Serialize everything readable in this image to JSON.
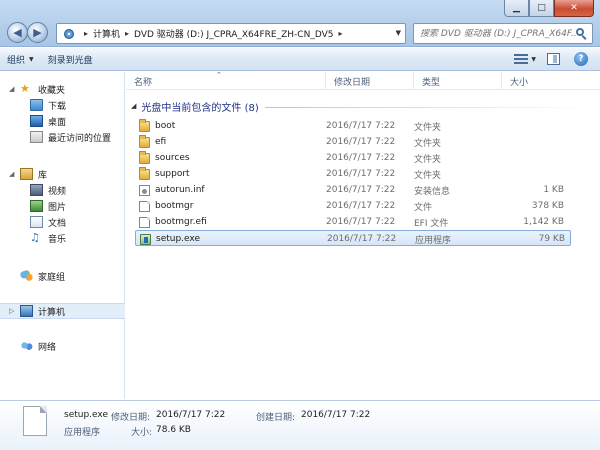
{
  "address": {
    "crumbs": [
      "计算机",
      "DVD 驱动器 (D:) J_CPRA_X64FRE_ZH-CN_DV5"
    ],
    "search_placeholder": "搜索 DVD 驱动器 (D:) J_CPRA_X64F..."
  },
  "toolbar": {
    "organize_label": "组织",
    "burn_label": "刻录到光盘"
  },
  "columns": {
    "name": "名称",
    "date": "修改日期",
    "type": "类型",
    "size": "大小"
  },
  "nav": {
    "favorites": {
      "label": "收藏夹",
      "items": [
        "下载",
        "桌面",
        "最近访问的位置"
      ]
    },
    "libraries": {
      "label": "库",
      "items": [
        "视频",
        "图片",
        "文档",
        "音乐"
      ]
    },
    "homegroup": "家庭组",
    "computer": "计算机",
    "network": "网络"
  },
  "group_header": "光盘中当前包含的文件 (8)",
  "files": [
    {
      "name": "boot",
      "date": "2016/7/17 7:22",
      "type": "文件夹",
      "size": "",
      "icon": "folder-icon"
    },
    {
      "name": "efi",
      "date": "2016/7/17 7:22",
      "type": "文件夹",
      "size": "",
      "icon": "folder-icon"
    },
    {
      "name": "sources",
      "date": "2016/7/17 7:22",
      "type": "文件夹",
      "size": "",
      "icon": "folder-icon"
    },
    {
      "name": "support",
      "date": "2016/7/17 7:22",
      "type": "文件夹",
      "size": "",
      "icon": "folder-icon"
    },
    {
      "name": "autorun.inf",
      "date": "2016/7/17 7:22",
      "type": "安装信息",
      "size": "1 KB",
      "icon": "setup-info-icon"
    },
    {
      "name": "bootmgr",
      "date": "2016/7/17 7:22",
      "type": "文件",
      "size": "378 KB",
      "icon": "file-icon"
    },
    {
      "name": "bootmgr.efi",
      "date": "2016/7/17 7:22",
      "type": "EFI 文件",
      "size": "1,142 KB",
      "icon": "file-icon"
    },
    {
      "name": "setup.exe",
      "date": "2016/7/17 7:22",
      "type": "应用程序",
      "size": "79 KB",
      "icon": "application-icon"
    }
  ],
  "selected_file": "setup.exe",
  "details": {
    "name": "setup.exe",
    "type": "应用程序",
    "modified_label": "修改日期:",
    "modified_value": "2016/7/17 7:22",
    "created_label": "创建日期:",
    "created_value": "2016/7/17 7:22",
    "size_label": "大小:",
    "size_value": "78.6 KB"
  },
  "colors": {
    "accent": "#3399ff",
    "group_header_text": "#1e3287",
    "selection_border": "#84acdd",
    "secondary_text": "#6d6d6d"
  }
}
